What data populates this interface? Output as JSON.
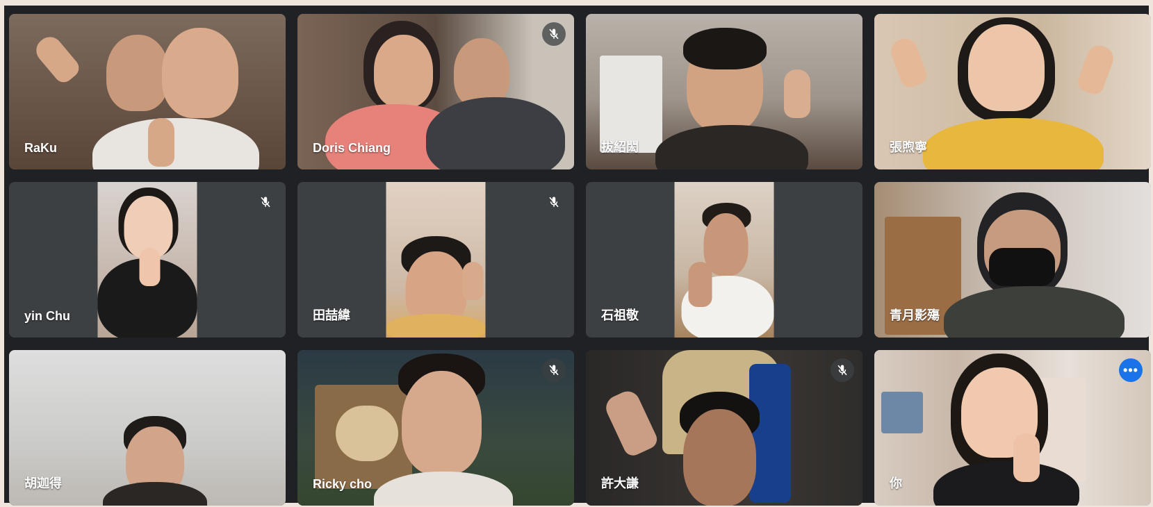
{
  "meeting": {
    "participants": [
      {
        "name": "RaKu",
        "muted": false,
        "bg": "#6b5a4d"
      },
      {
        "name": "Doris Chiang",
        "muted": true,
        "bg": "#8b7766"
      },
      {
        "name": "拔紹閎",
        "muted": false,
        "bg": "#b8aea5"
      },
      {
        "name": "張煦寧",
        "muted": false,
        "bg": "#d8c6a8"
      },
      {
        "name": "yin Chu",
        "muted": true,
        "bg": "#c9b8a8"
      },
      {
        "name": "田喆緯",
        "muted": true,
        "bg": "#d8c3b0"
      },
      {
        "name": "石祖敬",
        "muted": false,
        "bg": "#cfc3b3"
      },
      {
        "name": "青月影殤",
        "muted": false,
        "bg": "#a89f97"
      },
      {
        "name": "胡迦得",
        "muted": false,
        "bg": "#d3d3d0"
      },
      {
        "name": "Ricky cho",
        "muted": true,
        "bg": "#2d3f44"
      },
      {
        "name": "許大謙",
        "muted": true,
        "bg": "#2b2a29"
      },
      {
        "name": "你",
        "muted": false,
        "bg": "#cbbeb4",
        "is_self": true
      }
    ],
    "more_options_label": "•••"
  },
  "colors": {
    "background": "#202124",
    "tile": "#3c4043",
    "self_border": "#8ab4f8",
    "more_button": "#1a73e8"
  },
  "icons": {
    "muted": "mic-off-icon",
    "more": "more-horiz-icon"
  }
}
